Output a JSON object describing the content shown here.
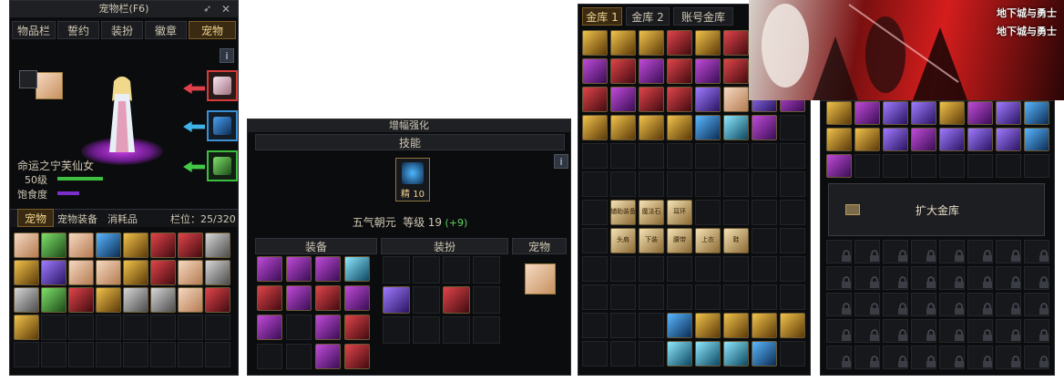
{
  "pet_panel": {
    "title": "宠物栏(F6)",
    "tabs": [
      "物品栏",
      "誓约",
      "装扮",
      "徽章",
      "宠物"
    ],
    "active_tab": "宠物",
    "pet_name": "命运之宁芙仙女",
    "level_label": "50级",
    "hunger_label": "饱食度",
    "info_button": "i",
    "sub_tabs": [
      "宠物",
      "宠物装备",
      "消耗品"
    ],
    "slot_label": "栏位：25/320"
  },
  "enhance_panel": {
    "title": "增幅强化",
    "skill_header": "技能",
    "skill_badge": "精 10",
    "skill_name": "五气朝元",
    "skill_level_label": "等级",
    "skill_level": "19",
    "skill_bonus": "(+9)",
    "info_button": "i",
    "section_equip": "装备",
    "section_avatar": "装扮",
    "section_pet": "宠物"
  },
  "vault_left": {
    "tabs": [
      "金库 1",
      "金库 2",
      "账号金库"
    ],
    "labeled_items": [
      "辅助装备",
      "魔法石",
      "耳环",
      "头肩",
      "下装",
      "腰带",
      "上衣",
      "鞋"
    ]
  },
  "banner": {
    "logo_top": "地下城与勇士",
    "logo_bottom": "地下城与勇士"
  },
  "vault_right": {
    "expand_button": "扩大金库"
  },
  "colors": {
    "panel_bg": "#0b0c0e",
    "gold_text": "#e1c98a",
    "green_text": "#5fd05f",
    "active_tab": "#3a2a12",
    "hp_bar": "#3fbf3f",
    "hunger_bar": "#7b2fc9"
  }
}
